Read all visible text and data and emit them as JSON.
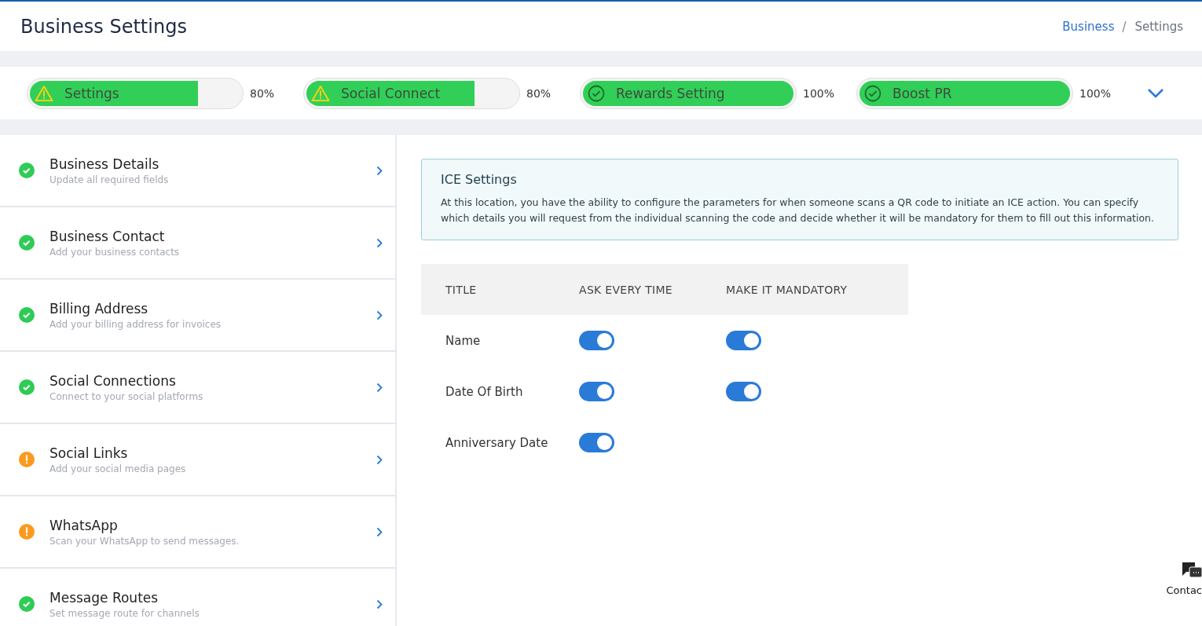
{
  "header": {
    "title": "Business Settings",
    "breadcrumb": [
      {
        "label": "Business",
        "link": true
      },
      {
        "label": "Settings",
        "link": false
      }
    ]
  },
  "progress": [
    {
      "label": "Settings",
      "kind": "warning",
      "level": 0.8,
      "reading": "80%"
    },
    {
      "label": "Social Connect",
      "kind": "warning",
      "level": 0.8,
      "reading": "80%"
    },
    {
      "label": "Rewards Setting",
      "kind": "done",
      "level": 1,
      "reading": "100%"
    },
    {
      "label": "Boost PR",
      "kind": "done",
      "level": 1,
      "reading": "100%"
    }
  ],
  "sidebar": {
    "items": [
      {
        "title": "Business Details",
        "subtitle": "Update all required fields",
        "kind": "done"
      },
      {
        "title": "Business Contact",
        "subtitle": "Add your business contacts",
        "kind": "done"
      },
      {
        "title": "Billing Address",
        "subtitle": "Add your billing address for invoices",
        "kind": "done"
      },
      {
        "title": "Social Connections",
        "subtitle": "Connect to your social platforms",
        "kind": "done"
      },
      {
        "title": "Social Links",
        "subtitle": "Add your social media pages",
        "kind": "warning"
      },
      {
        "title": "WhatsApp",
        "subtitle": "Scan your WhatsApp to send messages.",
        "kind": "warning"
      },
      {
        "title": "Message Routes",
        "subtitle": "Set message route for channels",
        "kind": "done"
      }
    ]
  },
  "info": {
    "title": "ICE Settings",
    "text": "At this location, you have the ability to configure the parameters for when someone scans a QR code to initiate an ICE action. You can specify which details you will request from the individual scanning the code and decide whether it will be mandatory for them to fill out this information."
  },
  "table": {
    "columns": [
      "TITLE",
      "ASK EVERY TIME",
      "MAKE IT MANDATORY"
    ],
    "rows": [
      {
        "title": "Name",
        "ask": true,
        "mandatory": true
      },
      {
        "title": "Date Of Birth",
        "ask": true,
        "mandatory": true
      },
      {
        "title": "Anniversary Date",
        "ask": true
      }
    ]
  },
  "contact_widget": {
    "label": "Contac"
  }
}
